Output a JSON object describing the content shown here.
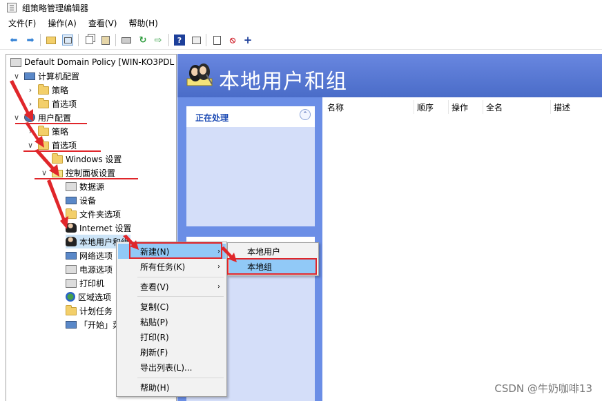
{
  "window": {
    "title": "组策略管理编辑器"
  },
  "menu": [
    "文件(F)",
    "操作(A)",
    "查看(V)",
    "帮助(H)"
  ],
  "toolbar": [
    "back-arrow-icon",
    "forward-arrow-icon",
    "up-folder-icon",
    "show-tree-icon",
    "copy-icon",
    "paste-icon",
    "print-icon",
    "refresh-icon",
    "export-icon",
    "help-icon",
    "properties-icon",
    "new-item-icon",
    "stop-icon",
    "add-icon"
  ],
  "tree": {
    "root": "Default Domain Policy [WIN-KO3PDL",
    "computer_config": "计算机配置",
    "policy1": "策略",
    "pref1": "首选项",
    "user_config": "用户配置",
    "policy2": "策略",
    "pref2": "首选项",
    "windows_settings": "Windows 设置",
    "control_panel": "控制面板设置",
    "data_sources": "数据源",
    "devices": "设备",
    "folder_options": "文件夹选项",
    "internet": "Internet 设置",
    "local_users": "本地用户和组",
    "network": "网络选项",
    "power": "电源选项",
    "printers": "打印机",
    "regional": "区域选项",
    "tasks": "计划任务",
    "start": "「开始」菜"
  },
  "banner": {
    "title": "本地用户和组"
  },
  "task_panel": {
    "title": "正在处理"
  },
  "columns": [
    "名称",
    "顺序",
    "操作",
    "全名",
    "描述"
  ],
  "context_menu": {
    "new": "新建(N)",
    "all_tasks": "所有任务(K)",
    "view": "查看(V)",
    "copy": "复制(C)",
    "paste": "粘贴(P)",
    "print": "打印(R)",
    "refresh": "刷新(F)",
    "export": "导出列表(L)...",
    "help": "帮助(H)"
  },
  "submenu": {
    "local_user": "本地用户",
    "local_group": "本地组"
  },
  "watermark": "CSDN @牛奶咖啡13",
  "colors": {
    "banner": "#5a7cd8",
    "task_panel": "#d4def9",
    "highlight": "#91c9f7",
    "annotation": "#e0262a"
  }
}
